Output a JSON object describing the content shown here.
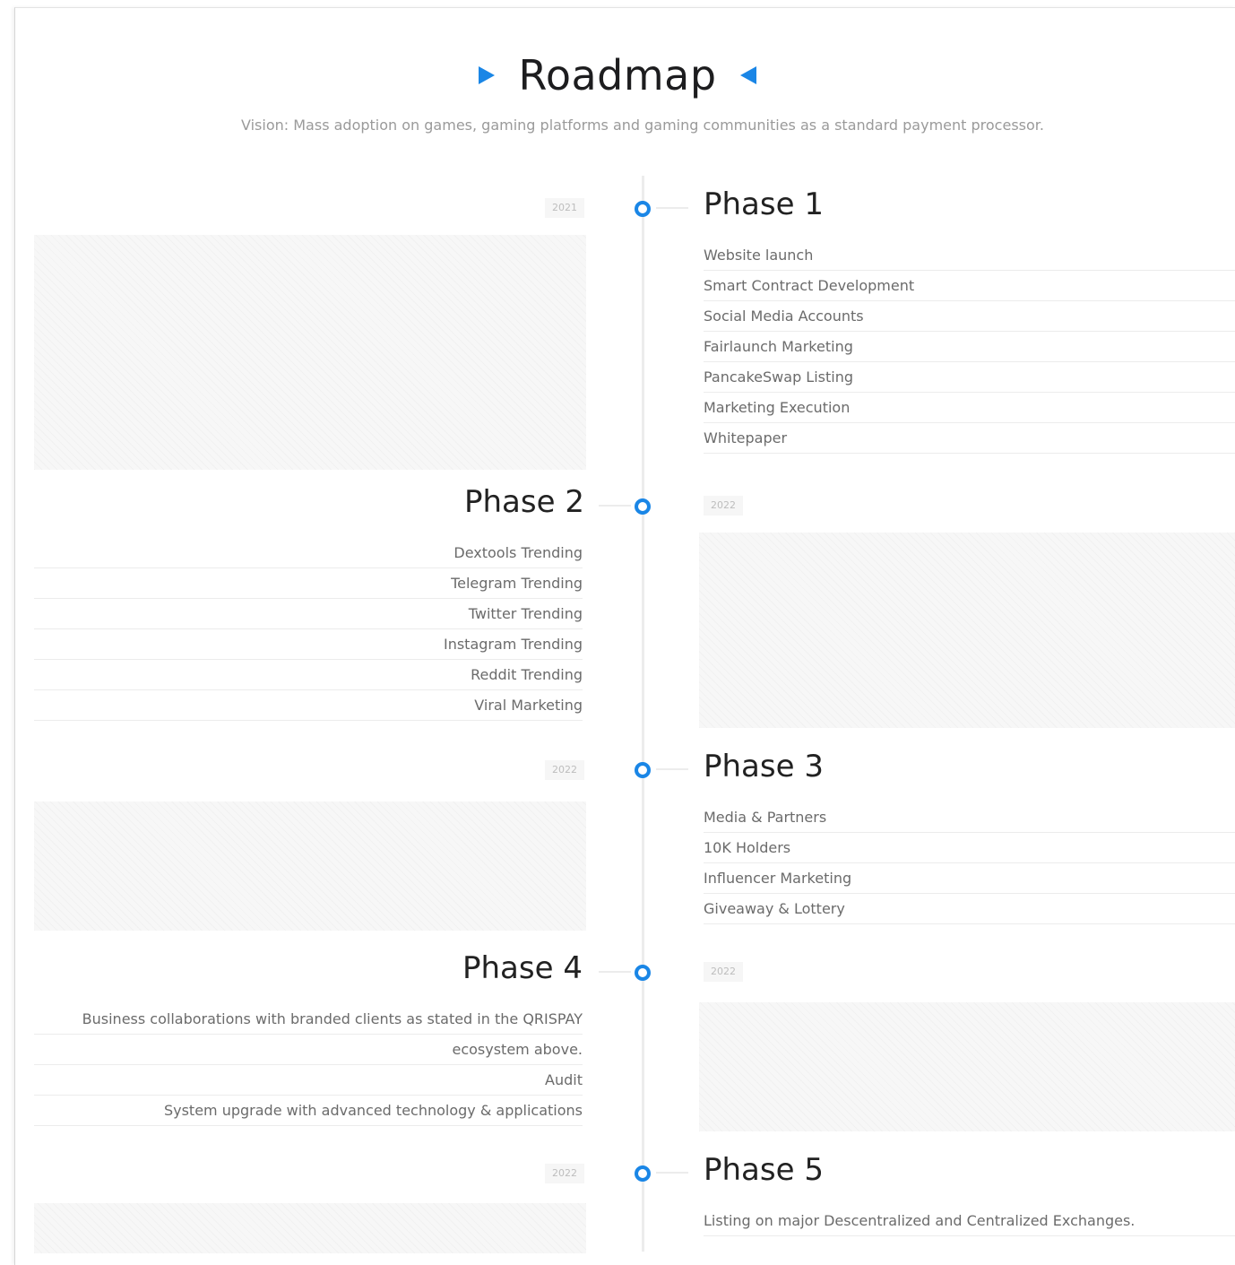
{
  "header": {
    "title": "Roadmap",
    "subtitle": "Vision: Mass adoption on games, gaming platforms and gaming communities as a standard payment processor.",
    "accent_color": "#1a86e6",
    "title_icons": [
      "triangle-right-icon",
      "triangle-left-icon"
    ]
  },
  "phases": [
    {
      "title": "Phase 1",
      "year": "2021",
      "items": [
        "Website launch",
        "Smart Contract Development",
        "Social Media Accounts",
        "Fairlaunch Marketing",
        "PancakeSwap Listing",
        "Marketing Execution",
        "Whitepaper"
      ]
    },
    {
      "title": "Phase 2",
      "year": "2022",
      "items": [
        "Dextools Trending",
        "Telegram Trending",
        "Twitter Trending",
        "Instagram Trending",
        "Reddit Trending",
        "Viral Marketing"
      ]
    },
    {
      "title": "Phase 3",
      "year": "2022",
      "items": [
        "Media & Partners",
        "10K Holders",
        "Influencer Marketing",
        "Giveaway & Lottery"
      ]
    },
    {
      "title": "Phase 4",
      "year": "2022",
      "items": [
        "Business collaborations with branded clients as stated in the QRISPAY",
        "ecosystem above.",
        "Audit",
        "System upgrade with advanced technology & applications"
      ]
    },
    {
      "title": "Phase 5",
      "year": "2022",
      "items": [
        "Listing on major Descentralized and Centralized Exchanges."
      ]
    }
  ]
}
